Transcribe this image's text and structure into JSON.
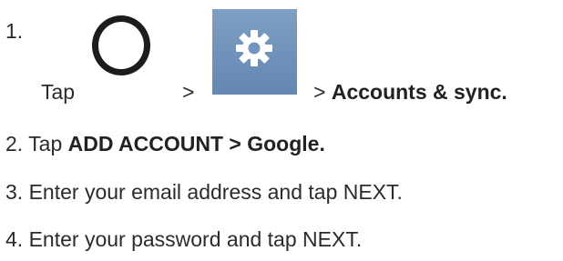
{
  "steps": [
    {
      "number": "1.",
      "tap": "Tap",
      "separator_1": ">",
      "separator_2": ">",
      "target": "Accounts & sync."
    },
    {
      "number": "2.",
      "prefix": "Tap",
      "action": "ADD ACCOUNT > Google."
    },
    {
      "number": "3.",
      "text": "Enter your email address and tap NEXT."
    },
    {
      "number": "4.",
      "text": "Enter your password and tap NEXT."
    }
  ],
  "icons": {
    "home": "home-circle-icon",
    "settings": "settings-gear-icon"
  },
  "colors": {
    "text": "#2b2b2b",
    "settings_tile": "#7196be",
    "gear": "#ffffff"
  }
}
